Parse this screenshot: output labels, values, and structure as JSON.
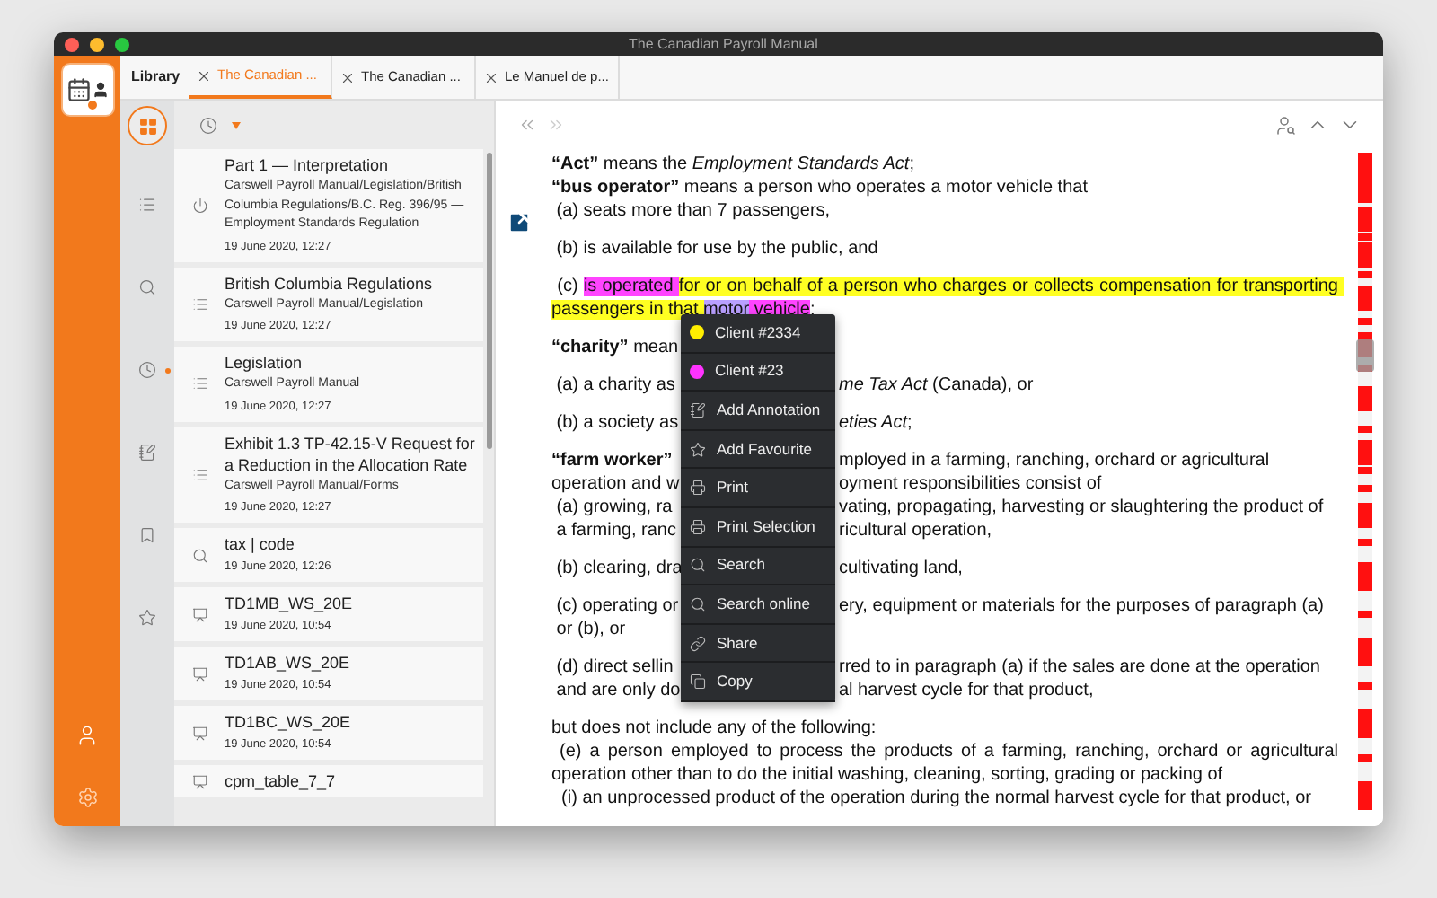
{
  "window": {
    "title": "The Canadian Payroll Manual"
  },
  "tabs": [
    {
      "label": "Library",
      "kind": "home",
      "selected": false
    },
    {
      "label": "The Canadian ...",
      "kind": "doc",
      "selected": true
    },
    {
      "label": "The Canadian ...",
      "kind": "doc",
      "selected": false
    },
    {
      "label": "Le Manuel de p...",
      "kind": "doc",
      "selected": false
    }
  ],
  "nav": [
    {
      "kind": "grid",
      "selected": true,
      "dot": false
    },
    {
      "kind": "list",
      "selected": false,
      "dot": false
    },
    {
      "kind": "search",
      "selected": false,
      "dot": false
    },
    {
      "kind": "history",
      "selected": false,
      "dot": true
    },
    {
      "kind": "annotation",
      "selected": false,
      "dot": false
    },
    {
      "kind": "bookmark",
      "selected": false,
      "dot": false
    },
    {
      "kind": "favourite",
      "selected": false,
      "dot": false
    }
  ],
  "library": {
    "items": [
      {
        "kind": "history",
        "title": "Part 1 — Interpretation",
        "path": "Carswell Payroll Manual/Legislation/British Columbia Regulations/B.C. Reg. 396/95 — Employment Standards Regulation",
        "date": "19 June 2020, 12:27"
      },
      {
        "kind": "list",
        "title": "British Columbia Regulations",
        "path": "Carswell Payroll Manual/Legislation",
        "date": "19 June 2020, 12:27"
      },
      {
        "kind": "list",
        "title": "Legislation",
        "path": "Carswell Payroll Manual",
        "date": "19 June 2020, 12:27"
      },
      {
        "kind": "list",
        "title": "Exhibit 1.3 TP-42.15-V Request for a Reduction in the Allocation Rate",
        "path": "Carswell Payroll Manual/Forms",
        "date": "19 June 2020, 12:27"
      },
      {
        "kind": "search",
        "title": "tax | code",
        "date": "19 June 2020, 12:26"
      },
      {
        "kind": "form",
        "title": "TD1MB_WS_20E",
        "date": "19 June 2020, 10:54"
      },
      {
        "kind": "form",
        "title": "TD1AB_WS_20E",
        "date": "19 June 2020, 10:54"
      },
      {
        "kind": "form",
        "title": "TD1BC_WS_20E",
        "date": "19 June 2020, 10:54"
      },
      {
        "kind": "form",
        "title": "cpm_table_7_7"
      }
    ]
  },
  "document": {
    "blocks": [
      {
        "lines": [
          {
            "kind": "text",
            "text": "**“Act”** means the *Employment Standards Act*;"
          },
          {
            "kind": "text",
            "text": "**“bus operator”** means a person who operates a motor vehicle that"
          },
          {
            "kind": "text",
            "text": " (a) seats more than 7 passengers,"
          }
        ]
      },
      {
        "lines": [
          {
            "kind": "text",
            "text": " (b) is available for use by the public, and"
          }
        ]
      },
      {
        "lines": [
          {
            "kind": "marked",
            "segments": [
              {
                "text": " (c) "
              },
              {
                "text": "is operated ",
                "color": "#ff44ff"
              },
              {
                "text": "for or on behalf of a person who charges or collects compensation for transporting passengers in that ",
                "color": "#ffff22"
              },
              {
                "text": "motor",
                "color": "#b9a0ff"
              },
              {
                "text": " vehicle",
                "color": "#ff44ff"
              },
              {
                "text": ";"
              }
            ]
          }
        ]
      },
      {
        "lines": [
          {
            "kind": "split",
            "left": "**“charity”** mean"
          }
        ]
      },
      {
        "lines": [
          {
            "kind": "split",
            "left": " (a) a charity as",
            "right": "*me Tax Act* (Canada), or"
          }
        ]
      },
      {
        "lines": [
          {
            "kind": "split",
            "left": " (b) a society as",
            "right": "*eties Act*;"
          }
        ]
      },
      {
        "lines": [
          {
            "kind": "split",
            "left": "**“farm worker”**",
            "right": "mployed in a farming, ranching, orchard or agricultural"
          },
          {
            "kind": "split",
            "left": "operation and w",
            "right": "oyment responsibilities consist of"
          },
          {
            "kind": "split",
            "left": " (a) growing, ra",
            "right": "vating, propagating, harvesting or slaughtering the product of"
          },
          {
            "kind": "split",
            "left": " a farming, ranc",
            "right": "ricultural operation,"
          }
        ]
      },
      {
        "lines": [
          {
            "kind": "split",
            "left": " (b) clearing, dra",
            "right": "cultivating land,"
          }
        ]
      },
      {
        "lines": [
          {
            "kind": "split",
            "left": " (c) operating or",
            "right": "ery, equipment or materials for the purposes of paragraph (a)"
          },
          {
            "kind": "text",
            "text": " or (b), or"
          }
        ]
      },
      {
        "lines": [
          {
            "kind": "split",
            "left": " (d) direct sellin",
            "right": "rred to in paragraph (a) if the sales are done at the operation"
          },
          {
            "kind": "split",
            "left": " and are only do",
            "right": "al harvest cycle for that product,"
          }
        ]
      },
      {
        "lines": [
          {
            "kind": "text",
            "text": "but does not include any of the following:"
          },
          {
            "kind": "justified",
            "text": " (e) a person employed to process the products of a farming, ranching, orchard or agricultural operation other than to do the initial washing, cleaning, sorting, grading or packing of"
          },
          {
            "kind": "text",
            "text": "  (i) an unprocessed product of the operation during the normal harvest cycle for that product, or"
          }
        ]
      }
    ]
  },
  "context_menu": {
    "items": [
      {
        "kind": "client",
        "label": "Client #2334",
        "color": "#ffee00"
      },
      {
        "kind": "client",
        "label": "Client #23",
        "color": "#ff33ff"
      },
      {
        "kind": "annotation",
        "label": "Add Annotation"
      },
      {
        "kind": "favourite",
        "label": "Add Favourite"
      },
      {
        "kind": "print",
        "label": "Print"
      },
      {
        "kind": "print",
        "label": "Print Selection"
      },
      {
        "kind": "search",
        "label": "Search"
      },
      {
        "kind": "search",
        "label": "Search online"
      },
      {
        "kind": "share",
        "label": "Share"
      },
      {
        "kind": "copy",
        "label": "Copy"
      }
    ]
  }
}
